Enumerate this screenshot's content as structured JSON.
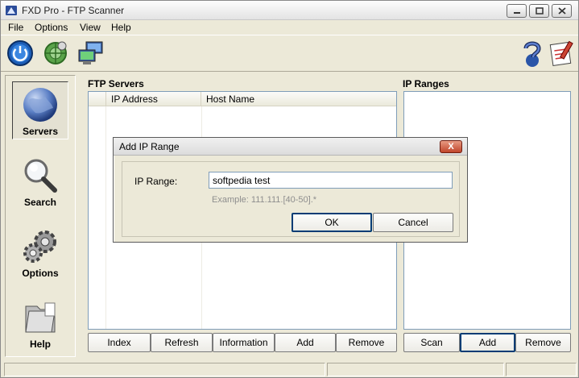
{
  "window": {
    "title": "FXD Pro - FTP Scanner"
  },
  "menu": {
    "items": [
      "File",
      "Options",
      "View",
      "Help"
    ]
  },
  "toolbar": {
    "left_icons": [
      "power-icon",
      "network-icon",
      "computers-icon"
    ],
    "right_icons": [
      "help-icon",
      "notes-icon"
    ]
  },
  "nav": {
    "items": [
      {
        "label": "Servers",
        "icon": "globe-icon",
        "active": true
      },
      {
        "label": "Search",
        "icon": "magnifier-icon",
        "active": false
      },
      {
        "label": "Options",
        "icon": "gears-icon",
        "active": false
      },
      {
        "label": "Help",
        "icon": "folder-icon",
        "active": false
      }
    ]
  },
  "ftp_servers": {
    "title": "FTP Servers",
    "columns": [
      "",
      "IP Address",
      "Host Name"
    ],
    "rows": [],
    "buttons": [
      "Index",
      "Refresh",
      "Information",
      "Add",
      "Remove"
    ]
  },
  "ip_ranges": {
    "title": "IP Ranges",
    "items": [],
    "buttons": [
      "Scan",
      "Add",
      "Remove"
    ]
  },
  "dialog": {
    "title": "Add IP Range",
    "field_label": "IP Range:",
    "field_value": "softpedia test",
    "example": "Example: 111.111.[40-50].*",
    "ok_label": "OK",
    "cancel_label": "Cancel",
    "close_glyph": "X"
  },
  "colors": {
    "accent_border": "#003c74",
    "list_border": "#7f9db9",
    "dialog_close": "#c0452a"
  }
}
